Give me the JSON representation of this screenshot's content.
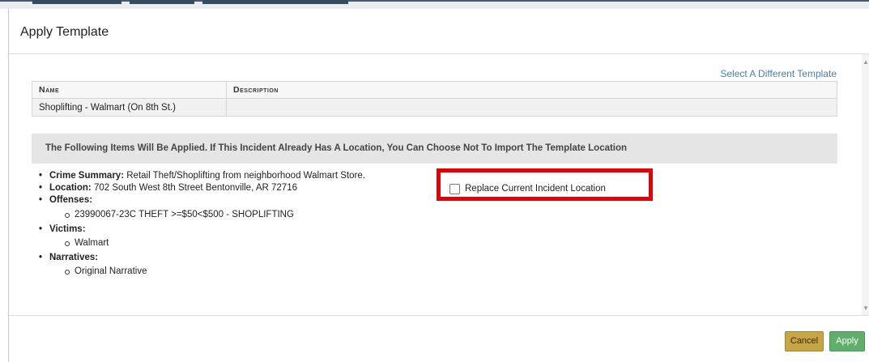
{
  "modal": {
    "title": "Apply Template",
    "select_link": "Select A Different Template"
  },
  "template_table": {
    "columns": [
      "Name",
      "Description"
    ],
    "rows": [
      {
        "name": "Shoplifting - Walmart (On 8th St.)",
        "description": ""
      }
    ]
  },
  "banner": "The Following Items Will Be Applied. If This Incident Already Has A Location, You Can Choose Not To Import The Template Location",
  "items": {
    "crime_summary": {
      "label": "Crime Summary:",
      "value": "Retail Theft/Shoplifting from neighborhood Walmart Store."
    },
    "location": {
      "label": "Location:",
      "value": "702 South West 8th Street Bentonville, AR 72716"
    },
    "offenses": {
      "label": "Offenses:",
      "values": [
        "23990067-23C THEFT >=$50<$500 - SHOPLIFTING"
      ]
    },
    "victims": {
      "label": "Victims:",
      "values": [
        "Walmart"
      ]
    },
    "narratives": {
      "label": "Narratives:",
      "values": [
        "Original Narrative"
      ]
    }
  },
  "replace_location": {
    "label": "Replace Current Incident Location",
    "checked": false
  },
  "buttons": {
    "cancel": "Cancel",
    "apply": "Apply"
  },
  "colors": {
    "link": "#4a7eb0",
    "highlight_box": "#e50000",
    "cancel_button": "#c7a444",
    "apply_button": "#5fae6a",
    "banner_bg": "#e5e5e5"
  }
}
